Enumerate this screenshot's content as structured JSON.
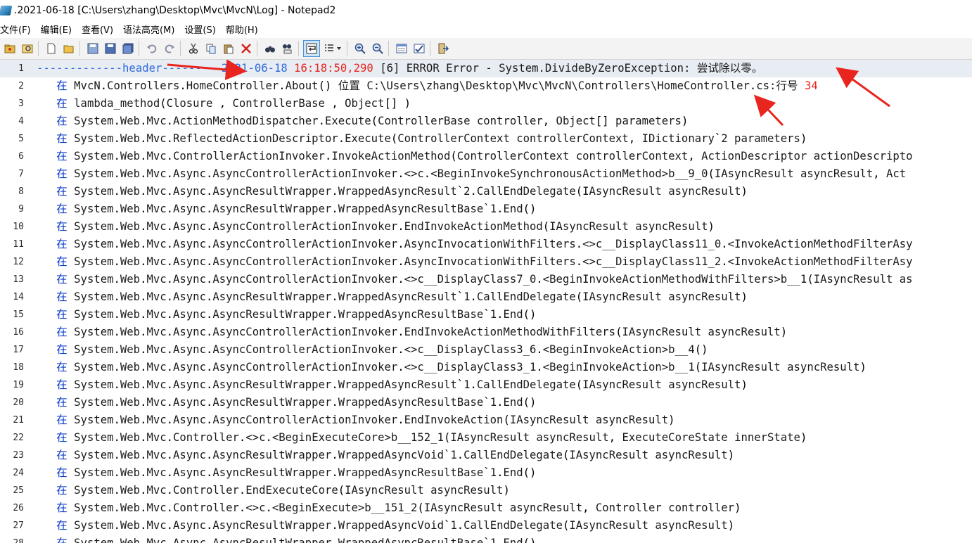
{
  "window": {
    "title": ".2021-06-18 [C:\\Users\\zhang\\Desktop\\Mvc\\MvcN\\Log] - Notepad2"
  },
  "menu": [
    "文件(F)",
    "编辑(E)",
    "查看(V)",
    "语法高亮(M)",
    "设置(S)",
    "帮助(H)"
  ],
  "toolbar": {
    "buttons": [
      "open-folder-icon",
      "browse-icon",
      "new-file-icon",
      "open-file-icon",
      "save-icon",
      "save-as-icon",
      "save-copy-icon",
      "undo-icon",
      "redo-icon",
      "cut-icon",
      "copy-icon",
      "paste-icon",
      "delete-icon",
      "find-icon",
      "replace-icon",
      "word-wrap-icon",
      "view-options-icon",
      "zoom-in-icon",
      "zoom-out-icon",
      "scheme-icon",
      "customize-icon",
      "exit-icon"
    ],
    "active": "word-wrap-icon"
  },
  "editor": {
    "lines": [
      {
        "n": "1",
        "text": "-------------header---------2021-06-18 16:18:50,290 [6] ERROR Error - System.DivideByZeroException: 尝试除以零。"
      },
      {
        "n": "2",
        "text": "   在 MvcN.Controllers.HomeController.About() 位置 C:\\Users\\zhang\\Desktop\\Mvc\\MvcN\\Controllers\\HomeController.cs:行号 34"
      },
      {
        "n": "3",
        "text": "   在 lambda_method(Closure , ControllerBase , Object[] )"
      },
      {
        "n": "4",
        "text": "   在 System.Web.Mvc.ActionMethodDispatcher.Execute(ControllerBase controller, Object[] parameters)"
      },
      {
        "n": "5",
        "text": "   在 System.Web.Mvc.ReflectedActionDescriptor.Execute(ControllerContext controllerContext, IDictionary`2 parameters)"
      },
      {
        "n": "6",
        "text": "   在 System.Web.Mvc.ControllerActionInvoker.InvokeActionMethod(ControllerContext controllerContext, ActionDescriptor actionDescripto"
      },
      {
        "n": "7",
        "text": "   在 System.Web.Mvc.Async.AsyncControllerActionInvoker.<>c.<BeginInvokeSynchronousActionMethod>b__9_0(IAsyncResult asyncResult, Act"
      },
      {
        "n": "8",
        "text": "   在 System.Web.Mvc.Async.AsyncResultWrapper.WrappedAsyncResult`2.CallEndDelegate(IAsyncResult asyncResult)"
      },
      {
        "n": "9",
        "text": "   在 System.Web.Mvc.Async.AsyncResultWrapper.WrappedAsyncResultBase`1.End()"
      },
      {
        "n": "10",
        "text": "   在 System.Web.Mvc.Async.AsyncControllerActionInvoker.EndInvokeActionMethod(IAsyncResult asyncResult)"
      },
      {
        "n": "11",
        "text": "   在 System.Web.Mvc.Async.AsyncControllerActionInvoker.AsyncInvocationWithFilters.<>c__DisplayClass11_0.<InvokeActionMethodFilterAsy"
      },
      {
        "n": "12",
        "text": "   在 System.Web.Mvc.Async.AsyncControllerActionInvoker.AsyncInvocationWithFilters.<>c__DisplayClass11_2.<InvokeActionMethodFilterAsy"
      },
      {
        "n": "13",
        "text": "   在 System.Web.Mvc.Async.AsyncControllerActionInvoker.<>c__DisplayClass7_0.<BeginInvokeActionMethodWithFilters>b__1(IAsyncResult as"
      },
      {
        "n": "14",
        "text": "   在 System.Web.Mvc.Async.AsyncResultWrapper.WrappedAsyncResult`1.CallEndDelegate(IAsyncResult asyncResult)"
      },
      {
        "n": "15",
        "text": "   在 System.Web.Mvc.Async.AsyncResultWrapper.WrappedAsyncResultBase`1.End()"
      },
      {
        "n": "16",
        "text": "   在 System.Web.Mvc.Async.AsyncControllerActionInvoker.EndInvokeActionMethodWithFilters(IAsyncResult asyncResult)"
      },
      {
        "n": "17",
        "text": "   在 System.Web.Mvc.Async.AsyncControllerActionInvoker.<>c__DisplayClass3_6.<BeginInvokeAction>b__4()"
      },
      {
        "n": "18",
        "text": "   在 System.Web.Mvc.Async.AsyncControllerActionInvoker.<>c__DisplayClass3_1.<BeginInvokeAction>b__1(IAsyncResult asyncResult)"
      },
      {
        "n": "19",
        "text": "   在 System.Web.Mvc.Async.AsyncResultWrapper.WrappedAsyncResult`1.CallEndDelegate(IAsyncResult asyncResult)"
      },
      {
        "n": "20",
        "text": "   在 System.Web.Mvc.Async.AsyncResultWrapper.WrappedAsyncResultBase`1.End()"
      },
      {
        "n": "21",
        "text": "   在 System.Web.Mvc.Async.AsyncControllerActionInvoker.EndInvokeAction(IAsyncResult asyncResult)"
      },
      {
        "n": "22",
        "text": "   在 System.Web.Mvc.Controller.<>c.<BeginExecuteCore>b__152_1(IAsyncResult asyncResult, ExecuteCoreState innerState)"
      },
      {
        "n": "23",
        "text": "   在 System.Web.Mvc.Async.AsyncResultWrapper.WrappedAsyncVoid`1.CallEndDelegate(IAsyncResult asyncResult)"
      },
      {
        "n": "24",
        "text": "   在 System.Web.Mvc.Async.AsyncResultWrapper.WrappedAsyncResultBase`1.End()"
      },
      {
        "n": "25",
        "text": "   在 System.Web.Mvc.Controller.EndExecuteCore(IAsyncResult asyncResult)"
      },
      {
        "n": "26",
        "text": "   在 System.Web.Mvc.Controller.<>c.<BeginExecute>b__151_2(IAsyncResult asyncResult, Controller controller)"
      },
      {
        "n": "27",
        "text": "   在 System.Web.Mvc.Async.AsyncResultWrapper.WrappedAsyncVoid`1.CallEndDelegate(IAsyncResult asyncResult)"
      },
      {
        "n": "28",
        "text": "   在 System.Web.Mvc.Async.AsyncResultWrapper.WrappedAsyncResultBase`1.End()"
      }
    ]
  },
  "colors": {
    "keyword_blue": "#0a3cc8",
    "number_red": "#e8251e",
    "header_blue": "#2f6cdc",
    "current_line": "#e8ecf3",
    "arrow_red": "#e8251e"
  }
}
